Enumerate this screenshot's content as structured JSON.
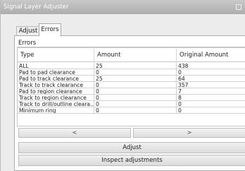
{
  "window": {
    "title": "Signal Layer Adjuster",
    "icon": "window-menu-icon"
  },
  "tabs": [
    {
      "label": "Adjust",
      "active": false
    },
    {
      "label": "Errors",
      "active": true
    }
  ],
  "errors": {
    "group_title": "Errors",
    "columns": [
      "Type",
      "Amount",
      "Original Amount"
    ],
    "rows": [
      [
        "ALL",
        "25",
        "438"
      ],
      [
        "Pad to pad clearance",
        "0",
        "0"
      ],
      [
        "Pad to track clearance",
        "25",
        "64"
      ],
      [
        "Track to track clearance",
        "0",
        "357"
      ],
      [
        "Pad to region clearance",
        "0",
        "7"
      ],
      [
        "Track to region clearance",
        "0",
        "8"
      ],
      [
        "Track to drill/outline cleara...",
        "0",
        "0"
      ],
      [
        "Minimum ring",
        "0",
        "0"
      ]
    ]
  },
  "nav": {
    "prev_label": "<",
    "next_label": ">"
  },
  "buttons": {
    "adjust_label": "Adjust",
    "inspect_label": "Inspect adjustments"
  }
}
